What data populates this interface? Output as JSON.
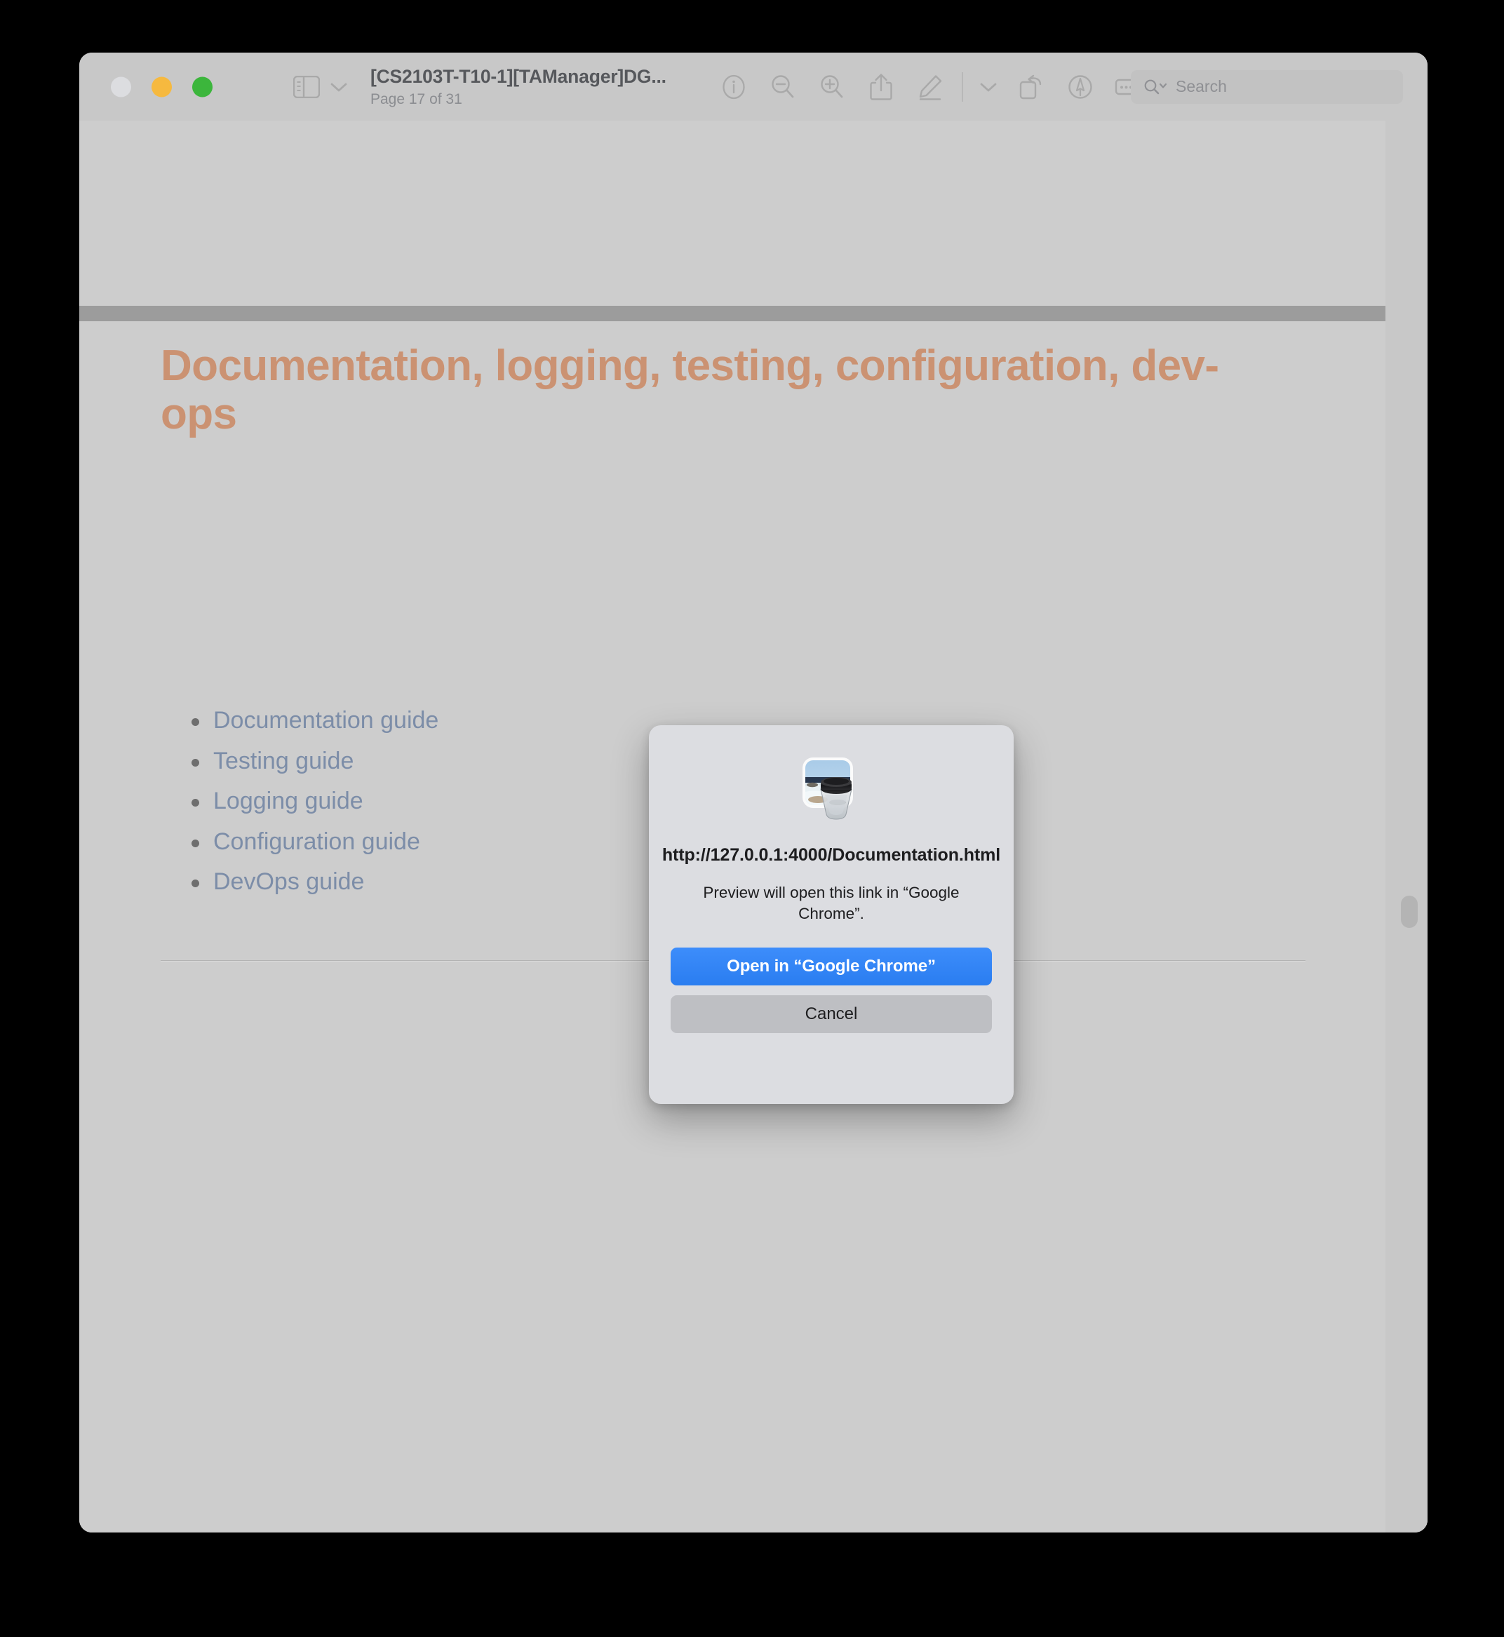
{
  "window": {
    "traffic_lights": [
      {
        "name": "close",
        "color": "#dcdde0"
      },
      {
        "name": "minimize",
        "color": "#f6b93f"
      },
      {
        "name": "zoom",
        "color": "#3cb63c"
      }
    ]
  },
  "toolbar": {
    "document_title": "[CS2103T-T10-1][TAManager]DG...",
    "page_indicator": "Page 17 of 31",
    "icons": [
      {
        "name": "sidebar-icon",
        "label": "Sidebar"
      },
      {
        "name": "chevron-down-icon",
        "label": "View options"
      },
      {
        "name": "info-icon",
        "label": "Show info"
      },
      {
        "name": "zoom-out-icon",
        "label": "Zoom out"
      },
      {
        "name": "zoom-in-icon",
        "label": "Zoom in"
      },
      {
        "name": "share-icon",
        "label": "Share"
      },
      {
        "name": "markup-pen-icon",
        "label": "Show markup toolbar"
      },
      {
        "name": "chevron-down-icon",
        "label": "Markup options"
      },
      {
        "name": "rotate-left-icon",
        "label": "Rotate left"
      },
      {
        "name": "annotate-pen-icon",
        "label": "Annotate"
      },
      {
        "name": "signature-icon",
        "label": "Sign"
      }
    ],
    "search": {
      "placeholder": "Search",
      "icon": "search-icon"
    }
  },
  "document": {
    "heading": "Documentation, logging, testing, configuration, dev-ops",
    "heading_color": "#cb9272",
    "link_color": "#7c8da8",
    "links": [
      {
        "label": "Documentation guide"
      },
      {
        "label": "Testing guide"
      },
      {
        "label": "Logging guide"
      },
      {
        "label": "Configuration guide"
      },
      {
        "label": "DevOps guide"
      }
    ]
  },
  "dialog": {
    "app_icon": "preview-app-icon",
    "url": "http://127.0.0.1:4000/Documentation.html",
    "message": "Preview will open this link in “Google Chrome”.",
    "primary_button": "Open in “Google Chrome”",
    "secondary_button": "Cancel",
    "primary_color": "#2a7df0"
  }
}
